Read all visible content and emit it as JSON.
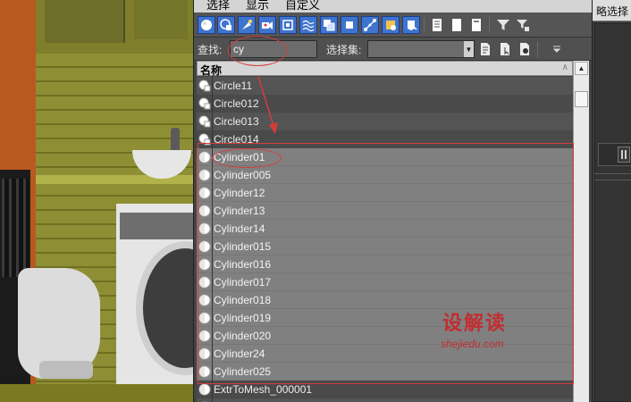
{
  "menu": {
    "items": [
      "选择",
      "显示",
      "自定义"
    ]
  },
  "toolbar": {
    "icons": [
      "display-geometry-icon",
      "display-shapes-icon",
      "display-lights-icon",
      "display-cameras-icon",
      "display-helpers-icon",
      "display-spacewarps-icon",
      "display-groups-icon",
      "display-xrefs-icon",
      "display-bones-icon",
      "display-particles-icon",
      "display-all-icon",
      "display-none-icon",
      "invert-display-icon",
      "filter-icon",
      "filter-options-icon"
    ]
  },
  "find": {
    "label": "查找:",
    "value": "cy",
    "selection_set_label": "选择集:",
    "selection_set_value": ""
  },
  "list_header": {
    "column_label": "名称",
    "sort_indicator": "∧"
  },
  "objects": [
    {
      "name": "Circle11",
      "type": "shape",
      "selected": false
    },
    {
      "name": "Circle012",
      "type": "shape",
      "selected": false
    },
    {
      "name": "Circle013",
      "type": "shape",
      "selected": false
    },
    {
      "name": "Circle014",
      "type": "shape",
      "selected": false
    },
    {
      "name": "Cylinder01",
      "type": "geometry",
      "selected": true
    },
    {
      "name": "Cylinder005",
      "type": "geometry",
      "selected": true
    },
    {
      "name": "Cylinder12",
      "type": "geometry",
      "selected": true
    },
    {
      "name": "Cylinder13",
      "type": "geometry",
      "selected": true
    },
    {
      "name": "Cylinder14",
      "type": "geometry",
      "selected": true
    },
    {
      "name": "Cylinder015",
      "type": "geometry",
      "selected": true
    },
    {
      "name": "Cylinder016",
      "type": "geometry",
      "selected": true
    },
    {
      "name": "Cylinder017",
      "type": "geometry",
      "selected": true
    },
    {
      "name": "Cylinder018",
      "type": "geometry",
      "selected": true
    },
    {
      "name": "Cylinder019",
      "type": "geometry",
      "selected": true
    },
    {
      "name": "Cylinder020",
      "type": "geometry",
      "selected": true
    },
    {
      "name": "Cylinder24",
      "type": "geometry",
      "selected": true
    },
    {
      "name": "Cylinder025",
      "type": "geometry",
      "selected": true
    },
    {
      "name": "ExtrToMesh_000001",
      "type": "geometry",
      "selected": false
    },
    {
      "name": "",
      "type": "geometry",
      "selected": false
    }
  ],
  "watermark": {
    "text": "设解读",
    "url": "shejiedu.com"
  },
  "right_panel": {
    "title": "略选择"
  },
  "colors": {
    "accent_blue": "#3f74cf",
    "annotation_red": "#d63c3c",
    "selected_row": "#808080",
    "row_bg": "#4c4c4c"
  }
}
